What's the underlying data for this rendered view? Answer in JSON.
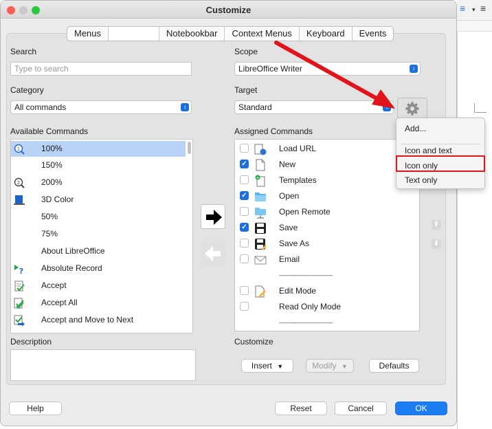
{
  "dialog": {
    "title": "Customize",
    "tabs": [
      "Menus",
      "",
      "Notebookbar",
      "Context Menus",
      "Keyboard",
      "Events"
    ]
  },
  "left": {
    "search_label": "Search",
    "search_placeholder": "Type to search",
    "category_label": "Category",
    "category_value": "All commands",
    "available_label": "Available Commands",
    "available_commands": [
      {
        "label": "100%",
        "icon": "zoom-100-icon",
        "selected": true
      },
      {
        "label": "150%",
        "icon": "",
        "selected": false
      },
      {
        "label": "200%",
        "icon": "zoom-200-icon",
        "selected": false
      },
      {
        "label": "3D Color",
        "icon": "3d-color-icon",
        "selected": false
      },
      {
        "label": "50%",
        "icon": "",
        "selected": false
      },
      {
        "label": "75%",
        "icon": "",
        "selected": false
      },
      {
        "label": "About LibreOffice",
        "icon": "",
        "selected": false
      },
      {
        "label": "Absolute Record",
        "icon": "absolute-record-icon",
        "selected": false
      },
      {
        "label": "Accept",
        "icon": "accept-icon",
        "selected": false
      },
      {
        "label": "Accept All",
        "icon": "accept-all-icon",
        "selected": false
      },
      {
        "label": "Accept and Move to Next",
        "icon": "accept-move-next-icon",
        "selected": false
      }
    ],
    "description_label": "Description"
  },
  "right": {
    "scope_label": "Scope",
    "scope_value": "LibreOffice Writer",
    "target_label": "Target",
    "target_value": "Standard",
    "assigned_label": "Assigned Commands",
    "assigned_commands": [
      {
        "label": "Load URL",
        "checked": false,
        "icon": "load-url-icon"
      },
      {
        "label": "New",
        "checked": true,
        "icon": "new-document-icon"
      },
      {
        "label": "Templates",
        "checked": false,
        "icon": "templates-icon"
      },
      {
        "label": "Open",
        "checked": true,
        "icon": "open-folder-icon"
      },
      {
        "label": "Open Remote",
        "checked": false,
        "icon": "open-remote-icon"
      },
      {
        "label": "Save",
        "checked": true,
        "icon": "save-icon"
      },
      {
        "label": "Save As",
        "checked": false,
        "icon": "save-as-icon"
      },
      {
        "label": "Email",
        "checked": false,
        "icon": "email-icon"
      },
      {
        "label": "------------------------------------",
        "checked": null,
        "icon": ""
      },
      {
        "label": "Edit Mode",
        "checked": false,
        "icon": "edit-mode-icon"
      },
      {
        "label": "Read Only Mode",
        "checked": false,
        "icon": ""
      },
      {
        "label": "------------------------------------",
        "checked": null,
        "icon": ""
      }
    ],
    "customize_label": "Customize",
    "insert_label": "Insert",
    "modify_label": "Modify",
    "defaults_label": "Defaults"
  },
  "gear_menu": {
    "items": [
      "Add...",
      "Icon and text",
      "Icon only",
      "Text only"
    ],
    "highlighted": "Icon only"
  },
  "footer": {
    "help": "Help",
    "reset": "Reset",
    "cancel": "Cancel",
    "ok": "OK"
  },
  "colors": {
    "accent": "#1c7df2",
    "annotation_red": "#e0141a",
    "selection": "#b8d3f6"
  }
}
